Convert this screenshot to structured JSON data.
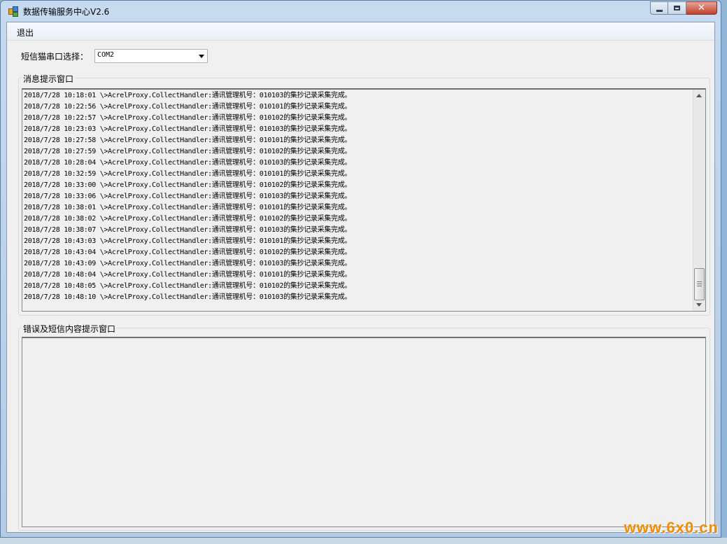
{
  "window": {
    "title": "数据传输服务中心V2.6"
  },
  "menu": {
    "exit_label": "退出"
  },
  "port": {
    "label": "短信猫串口选择：",
    "selected": "COM2"
  },
  "message_panel": {
    "legend": "消息提示窗口",
    "lines": [
      "2018/7/28 10:18:01 \\>AcrelProxy.CollectHandler:通讯管理机号：010103的集抄记录采集完成。",
      "2018/7/28 10:22:56 \\>AcrelProxy.CollectHandler:通讯管理机号：010101的集抄记录采集完成。",
      "2018/7/28 10:22:57 \\>AcrelProxy.CollectHandler:通讯管理机号：010102的集抄记录采集完成。",
      "2018/7/28 10:23:03 \\>AcrelProxy.CollectHandler:通讯管理机号：010103的集抄记录采集完成。",
      "2018/7/28 10:27:58 \\>AcrelProxy.CollectHandler:通讯管理机号：010101的集抄记录采集完成。",
      "2018/7/28 10:27:59 \\>AcrelProxy.CollectHandler:通讯管理机号：010102的集抄记录采集完成。",
      "2018/7/28 10:28:04 \\>AcrelProxy.CollectHandler:通讯管理机号：010103的集抄记录采集完成。",
      "2018/7/28 10:32:59 \\>AcrelProxy.CollectHandler:通讯管理机号：010101的集抄记录采集完成。",
      "2018/7/28 10:33:00 \\>AcrelProxy.CollectHandler:通讯管理机号：010102的集抄记录采集完成。",
      "2018/7/28 10:33:06 \\>AcrelProxy.CollectHandler:通讯管理机号：010103的集抄记录采集完成。",
      "2018/7/28 10:38:01 \\>AcrelProxy.CollectHandler:通讯管理机号：010101的集抄记录采集完成。",
      "2018/7/28 10:38:02 \\>AcrelProxy.CollectHandler:通讯管理机号：010102的集抄记录采集完成。",
      "2018/7/28 10:38:07 \\>AcrelProxy.CollectHandler:通讯管理机号：010103的集抄记录采集完成。",
      "2018/7/28 10:43:03 \\>AcrelProxy.CollectHandler:通讯管理机号：010101的集抄记录采集完成。",
      "2018/7/28 10:43:04 \\>AcrelProxy.CollectHandler:通讯管理机号：010102的集抄记录采集完成。",
      "2018/7/28 10:43:09 \\>AcrelProxy.CollectHandler:通讯管理机号：010103的集抄记录采集完成。",
      "2018/7/28 10:48:04 \\>AcrelProxy.CollectHandler:通讯管理机号：010101的集抄记录采集完成。",
      "2018/7/28 10:48:05 \\>AcrelProxy.CollectHandler:通讯管理机号：010102的集抄记录采集完成。",
      "2018/7/28 10:48:10 \\>AcrelProxy.CollectHandler:通讯管理机号：010103的集抄记录采集完成。"
    ]
  },
  "error_panel": {
    "legend": "错误及短信内容提示窗口"
  },
  "watermark": {
    "text": "www.6x0.cn",
    "color": "#f28c00"
  },
  "icons": [
    "app-icon",
    "minimize-icon",
    "maximize-icon",
    "close-icon",
    "chevron-down-icon",
    "scroll-up-arrow-icon",
    "scroll-down-arrow-icon"
  ]
}
